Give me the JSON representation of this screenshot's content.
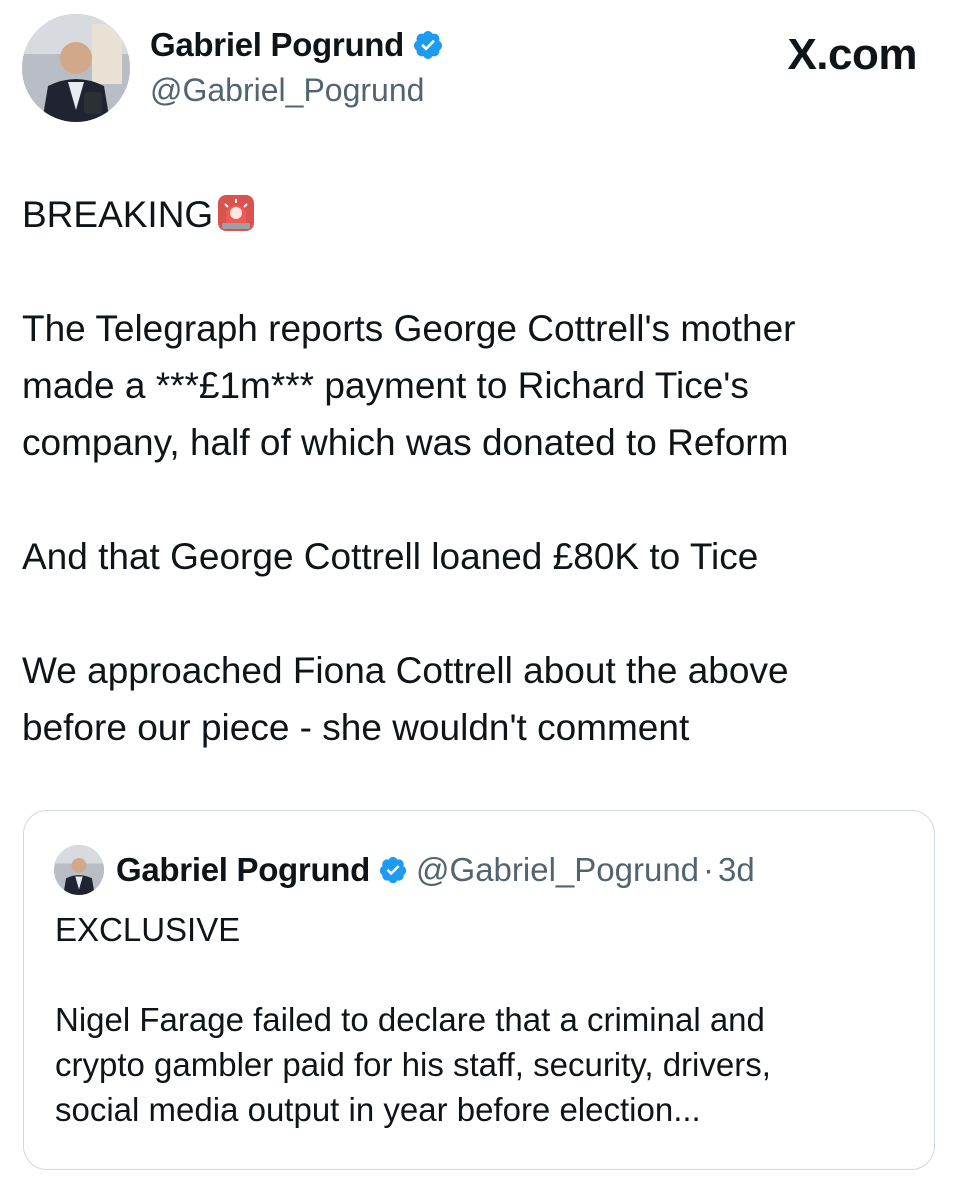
{
  "author": {
    "name": "Gabriel Pogrund",
    "handle": "@Gabriel_Pogrund",
    "verified": true
  },
  "brand": "X.com",
  "tweet": {
    "headline": "BREAKING",
    "headline_icon": "police-siren-icon",
    "lines": [
      "The Telegraph reports George Cottrell's mother",
      "made a ***£1m*** payment to Richard Tice's",
      "company, half of which was donated to Reform"
    ],
    "line2": "And that George Cottrell loaned £80K to Tice",
    "lines3": [
      "We approached Fiona Cottrell about the above",
      "before our piece - she wouldn't comment"
    ]
  },
  "quoted": {
    "name": "Gabriel Pogrund",
    "handle": "@Gabriel_Pogrund",
    "separator": "·",
    "time": "3d",
    "verified": true,
    "headline": "EXCLUSIVE",
    "lines": [
      "Nigel Farage failed to declare that a criminal and",
      "crypto gambler paid for his staff, security, drivers,",
      "social media output in year before election..."
    ]
  },
  "colors": {
    "text": "#0f1419",
    "muted": "#536471",
    "verified": "#1d9bf0",
    "border": "#cfd9de"
  }
}
